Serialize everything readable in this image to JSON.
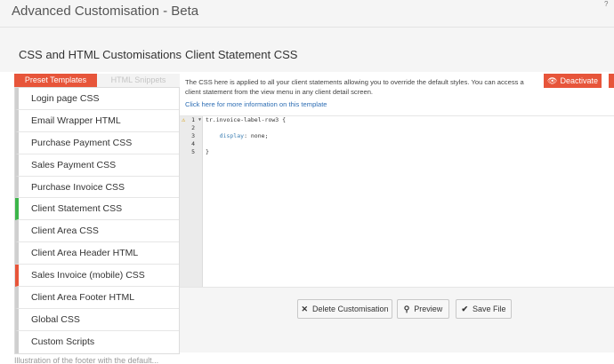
{
  "header": {
    "title": "Advanced Customisation - Beta",
    "help_icon": "?"
  },
  "sidebar": {
    "heading": "CSS and HTML Customisations",
    "tabs": [
      {
        "label": "Preset Templates",
        "active": true
      },
      {
        "label": "HTML Snippets",
        "active": false
      }
    ],
    "items": [
      {
        "label": "Login page CSS"
      },
      {
        "label": "Email Wrapper HTML"
      },
      {
        "label": "Purchase Payment CSS"
      },
      {
        "label": "Sales Payment CSS"
      },
      {
        "label": "Purchase Invoice CSS"
      },
      {
        "label": "Client Statement CSS",
        "status": "active"
      },
      {
        "label": "Client Area CSS"
      },
      {
        "label": "Client Area Header HTML"
      },
      {
        "label": "Sales Invoice (mobile) CSS",
        "status": "warning"
      },
      {
        "label": "Client Area Footer HTML"
      },
      {
        "label": "Global CSS"
      },
      {
        "label": "Custom Scripts"
      }
    ]
  },
  "main": {
    "heading": "Client Statement CSS",
    "description": "The CSS here is applied to all your client statements allowing you to override the default styles. You can access a client statement from the view menu in any client detail screen.",
    "info_link": "Click here for more information on this template",
    "deactivate_label": "Deactivate"
  },
  "editor": {
    "line_numbers": [
      "1",
      "2",
      "3",
      "4",
      "5"
    ],
    "lines": [
      {
        "selector": "tr.invoice-label-row3 {"
      },
      {
        "text": ""
      },
      {
        "indent": "    ",
        "property": "display",
        "value": ": none;"
      },
      {
        "text": ""
      },
      {
        "text": "}"
      }
    ]
  },
  "actions": {
    "delete_label": "Delete Customisation",
    "preview_label": "Preview",
    "save_label": "Save File"
  },
  "footer": {
    "partial_text": "Illustration of the footer with the default..."
  },
  "colors": {
    "accent": "#e7553a",
    "active_green": "#3cb54a",
    "link_blue": "#2f6fb5"
  }
}
